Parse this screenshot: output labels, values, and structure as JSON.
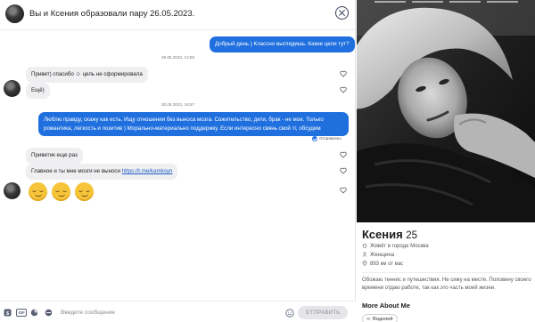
{
  "header": {
    "title": "Вы и Ксения образовали пару 26.05.2023."
  },
  "messages": {
    "m1_text": "Добрый день ) Классно выглядишь. Какие цели тут?",
    "date1": "29.05.2023, 14:56",
    "m2_text": "Привет) спасибо ☺ цель не сформировала",
    "m3_text": "Ещё)",
    "date2": "30.05.2023, 16:57",
    "m4_text": "Люблю правду, скажу как есть. Ищу отношения без выноса мозга. Сожительство, дети, брак - не мое. Только романтика, легкость и позитив ) Морально-материально поддержку. Если интересно свянь свой тг, обсудим",
    "m4_status": "Отправлено",
    "m5_text": "Приветик еще раз",
    "m6_text": "Главное и ты мне мозги не выноси",
    "m6_link": "https://t.me/kamksyn"
  },
  "input": {
    "placeholder": "Введите сообщение",
    "gif_label": "GIF",
    "send_label": "ОТПРАВИТЬ"
  },
  "profile": {
    "name": "Ксения",
    "age": "25",
    "city": "Живёт в городе Москва",
    "gender": "Женщина",
    "distance": "893 км от вас",
    "about": "Обожаю теннис и путешествия. Не сижу на месте. Половину своего времени отдаю работе, так как это часть моей жизни.",
    "more_title": "More About Me",
    "chip": "Водолей"
  },
  "colors": {
    "accent": "#1f6fde",
    "incoming_bubble": "#efeff1",
    "send_button": "#e6e6ea"
  },
  "icons": {
    "close": "close-circle-icon",
    "heart": "heart-outline-icon",
    "sent": "check-circle-icon",
    "emoji": "pensive-face-emoji",
    "toolbar": [
      "dollar-icon",
      "gif-icon",
      "sticker-icon",
      "emoji-bar-icon",
      "smile-icon"
    ],
    "profile": [
      "home-icon",
      "person-icon",
      "location-pin-icon",
      "aquarius-icon"
    ]
  }
}
